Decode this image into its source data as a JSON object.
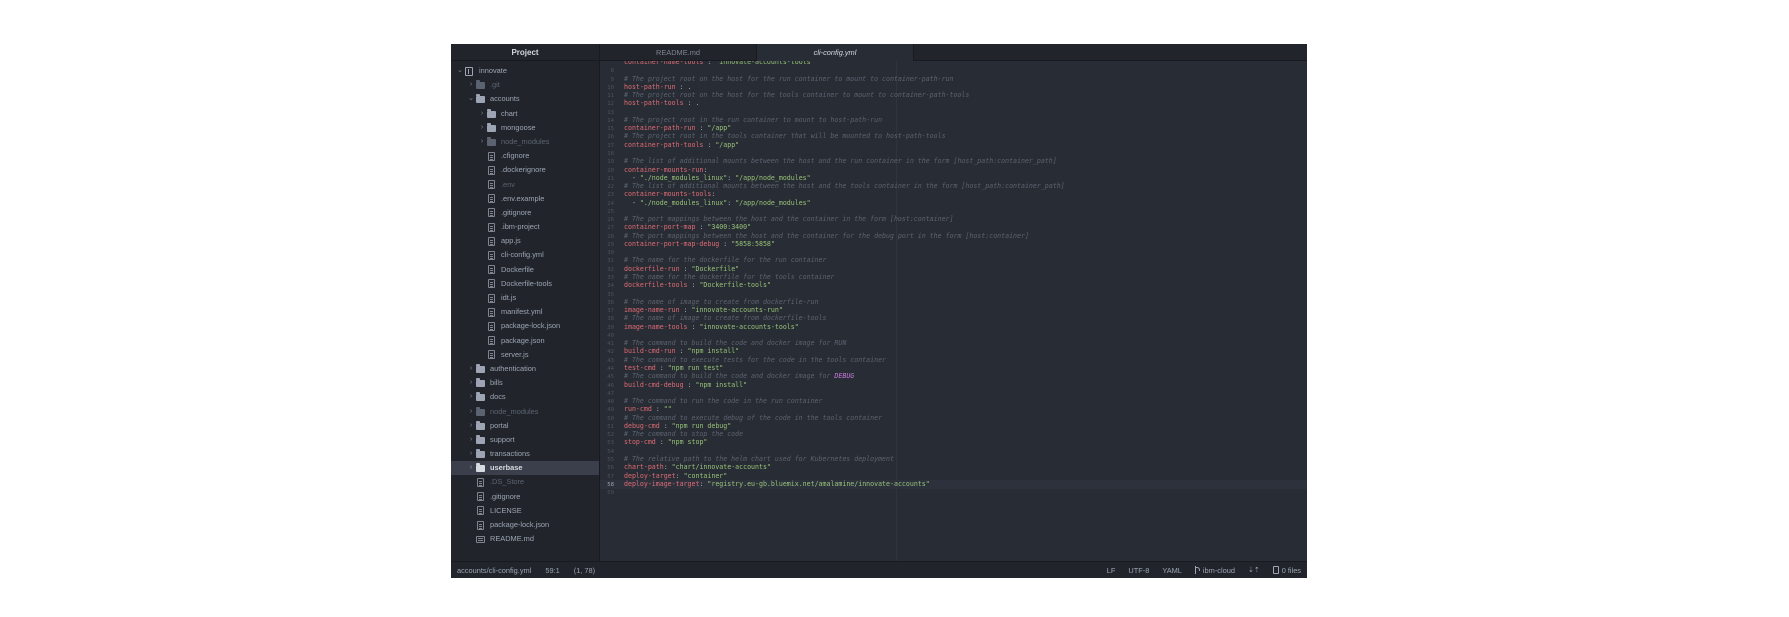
{
  "sidebar": {
    "title": "Project",
    "items": [
      {
        "label": "innovate",
        "kind": "repo",
        "depth": 0,
        "chev": "open"
      },
      {
        "label": ".git",
        "kind": "folder",
        "depth": 1,
        "chev": "closed",
        "dim": true
      },
      {
        "label": "accounts",
        "kind": "folder",
        "depth": 1,
        "chev": "open"
      },
      {
        "label": "chart",
        "kind": "folder",
        "depth": 2,
        "chev": "closed"
      },
      {
        "label": "mongoose",
        "kind": "folder",
        "depth": 2,
        "chev": "closed"
      },
      {
        "label": "node_modules",
        "kind": "folder",
        "depth": 2,
        "chev": "closed",
        "dim": true
      },
      {
        "label": ".cfignore",
        "kind": "file",
        "depth": 2
      },
      {
        "label": ".dockerignore",
        "kind": "file",
        "depth": 2
      },
      {
        "label": ".env",
        "kind": "file",
        "depth": 2,
        "dim": true
      },
      {
        "label": ".env.example",
        "kind": "file",
        "depth": 2
      },
      {
        "label": ".gitignore",
        "kind": "file",
        "depth": 2
      },
      {
        "label": ".ibm-project",
        "kind": "file",
        "depth": 2
      },
      {
        "label": "app.js",
        "kind": "file",
        "depth": 2
      },
      {
        "label": "cli-config.yml",
        "kind": "file",
        "depth": 2
      },
      {
        "label": "Dockerfile",
        "kind": "file",
        "depth": 2
      },
      {
        "label": "Dockerfile-tools",
        "kind": "file",
        "depth": 2
      },
      {
        "label": "idt.js",
        "kind": "file",
        "depth": 2
      },
      {
        "label": "manifest.yml",
        "kind": "file",
        "depth": 2
      },
      {
        "label": "package-lock.json",
        "kind": "file",
        "depth": 2
      },
      {
        "label": "package.json",
        "kind": "file",
        "depth": 2
      },
      {
        "label": "server.js",
        "kind": "file",
        "depth": 2
      },
      {
        "label": "authentication",
        "kind": "folder",
        "depth": 1,
        "chev": "closed"
      },
      {
        "label": "bills",
        "kind": "folder",
        "depth": 1,
        "chev": "closed"
      },
      {
        "label": "docs",
        "kind": "folder",
        "depth": 1,
        "chev": "closed"
      },
      {
        "label": "node_modules",
        "kind": "folder",
        "depth": 1,
        "chev": "closed",
        "dim": true
      },
      {
        "label": "portal",
        "kind": "folder",
        "depth": 1,
        "chev": "closed"
      },
      {
        "label": "support",
        "kind": "folder",
        "depth": 1,
        "chev": "closed"
      },
      {
        "label": "transactions",
        "kind": "folder",
        "depth": 1,
        "chev": "closed"
      },
      {
        "label": "userbase",
        "kind": "folder",
        "depth": 1,
        "chev": "closed",
        "selected": true
      },
      {
        "label": ".DS_Store",
        "kind": "file",
        "depth": 1,
        "dim": true
      },
      {
        "label": ".gitignore",
        "kind": "file",
        "depth": 1
      },
      {
        "label": "LICENSE",
        "kind": "file",
        "depth": 1
      },
      {
        "label": "package-lock.json",
        "kind": "file",
        "depth": 1
      },
      {
        "label": "README.md",
        "kind": "readme",
        "depth": 1
      }
    ]
  },
  "tabs": [
    {
      "label": "README.md",
      "active": false
    },
    {
      "label": "cli-config.yml",
      "active": true
    }
  ],
  "code": {
    "lines": [
      {
        "n": "",
        "t": [
          [
            "k",
            "container-name-tools"
          ],
          [
            "p",
            " : "
          ],
          [
            "s",
            "\"innovate-accounts-tools\""
          ]
        ]
      },
      {
        "n": "8",
        "t": []
      },
      {
        "n": "9",
        "t": [
          [
            "c",
            "# The project root on the host for the run container to mount to container-path-run"
          ]
        ]
      },
      {
        "n": "10",
        "t": [
          [
            "k",
            "host-path-run"
          ],
          [
            "p",
            " : ."
          ]
        ]
      },
      {
        "n": "11",
        "t": [
          [
            "c",
            "# The project root on the host for the tools container to mount to container-path-tools"
          ]
        ]
      },
      {
        "n": "12",
        "t": [
          [
            "k",
            "host-path-tools"
          ],
          [
            "p",
            " : ."
          ]
        ]
      },
      {
        "n": "13",
        "t": []
      },
      {
        "n": "14",
        "t": [
          [
            "c",
            "# The project root in the run container to mount to host-path-run"
          ]
        ]
      },
      {
        "n": "15",
        "t": [
          [
            "k",
            "container-path-run"
          ],
          [
            "p",
            " : "
          ],
          [
            "s",
            "\"/app\""
          ]
        ]
      },
      {
        "n": "16",
        "t": [
          [
            "c",
            "# The project root in the tools container that will be mounted to host-path-tools"
          ]
        ]
      },
      {
        "n": "17",
        "t": [
          [
            "k",
            "container-path-tools"
          ],
          [
            "p",
            " : "
          ],
          [
            "s",
            "\"/app\""
          ]
        ]
      },
      {
        "n": "18",
        "t": []
      },
      {
        "n": "19",
        "t": [
          [
            "c",
            "# The list of additional mounts between the host and the run container in the form [host_path:container_path]"
          ]
        ]
      },
      {
        "n": "20",
        "t": [
          [
            "k",
            "container-mounts-run"
          ],
          [
            "p",
            ":"
          ]
        ]
      },
      {
        "n": "21",
        "t": [
          [
            "p",
            "  - "
          ],
          [
            "s",
            "\"./node_modules_linux\""
          ],
          [
            "p",
            ": "
          ],
          [
            "s",
            "\"/app/node_modules\""
          ]
        ]
      },
      {
        "n": "22",
        "t": [
          [
            "c",
            "# The list of additional mounts between the host and the tools container in the form [host_path:container_path]"
          ]
        ]
      },
      {
        "n": "23",
        "t": [
          [
            "k",
            "container-mounts-tools"
          ],
          [
            "p",
            ":"
          ]
        ]
      },
      {
        "n": "24",
        "t": [
          [
            "p",
            "  - "
          ],
          [
            "s",
            "\"./node_modules_linux\""
          ],
          [
            "p",
            ": "
          ],
          [
            "s",
            "\"/app/node_modules\""
          ]
        ]
      },
      {
        "n": "25",
        "t": []
      },
      {
        "n": "26",
        "t": [
          [
            "c",
            "# The port mappings between the host and the container in the form [host:container]"
          ]
        ]
      },
      {
        "n": "27",
        "t": [
          [
            "k",
            "container-port-map"
          ],
          [
            "p",
            " : "
          ],
          [
            "s",
            "\"3400:3400\""
          ]
        ]
      },
      {
        "n": "28",
        "t": [
          [
            "c",
            "# The port mappings between the host and the container for the debug port in the form [host:container]"
          ]
        ]
      },
      {
        "n": "29",
        "t": [
          [
            "k",
            "container-port-map-debug"
          ],
          [
            "p",
            " : "
          ],
          [
            "s",
            "\"5858:5858\""
          ]
        ]
      },
      {
        "n": "30",
        "t": []
      },
      {
        "n": "31",
        "t": [
          [
            "c",
            "# The name for the dockerfile for the run container"
          ]
        ]
      },
      {
        "n": "32",
        "t": [
          [
            "k",
            "dockerfile-run"
          ],
          [
            "p",
            " : "
          ],
          [
            "s",
            "\"Dockerfile\""
          ]
        ]
      },
      {
        "n": "33",
        "t": [
          [
            "c",
            "# The name for the dockerfile for the tools container"
          ]
        ]
      },
      {
        "n": "34",
        "t": [
          [
            "k",
            "dockerfile-tools"
          ],
          [
            "p",
            " : "
          ],
          [
            "s",
            "\"Dockerfile-tools\""
          ]
        ]
      },
      {
        "n": "35",
        "t": []
      },
      {
        "n": "36",
        "t": [
          [
            "c",
            "# The name of image to create from dockerfile-run"
          ]
        ]
      },
      {
        "n": "37",
        "t": [
          [
            "k",
            "image-name-run"
          ],
          [
            "p",
            " : "
          ],
          [
            "s",
            "\"innovate-accounts-run\""
          ]
        ]
      },
      {
        "n": "38",
        "t": [
          [
            "c",
            "# The name of image to create from dockerfile-tools"
          ]
        ]
      },
      {
        "n": "39",
        "t": [
          [
            "k",
            "image-name-tools"
          ],
          [
            "p",
            " : "
          ],
          [
            "s",
            "\"innovate-accounts-tools\""
          ]
        ]
      },
      {
        "n": "40",
        "t": []
      },
      {
        "n": "41",
        "t": [
          [
            "c",
            "# The command to build the code and docker image for RUN"
          ]
        ]
      },
      {
        "n": "42",
        "t": [
          [
            "k",
            "build-cmd-run"
          ],
          [
            "p",
            " : "
          ],
          [
            "s",
            "\"npm install\""
          ]
        ]
      },
      {
        "n": "43",
        "t": [
          [
            "c",
            "# The command to execute tests for the code in the tools container"
          ]
        ]
      },
      {
        "n": "44",
        "t": [
          [
            "k",
            "test-cmd"
          ],
          [
            "p",
            " : "
          ],
          [
            "s",
            "\"npm run test\""
          ]
        ]
      },
      {
        "n": "45",
        "t": [
          [
            "c",
            "# The command to build the code and docker image for "
          ],
          [
            "kw",
            "DEBUG"
          ]
        ]
      },
      {
        "n": "46",
        "t": [
          [
            "k",
            "build-cmd-debug"
          ],
          [
            "p",
            " : "
          ],
          [
            "s",
            "\"npm install\""
          ]
        ]
      },
      {
        "n": "47",
        "t": []
      },
      {
        "n": "48",
        "t": [
          [
            "c",
            "# The command to run the code in the run container"
          ]
        ]
      },
      {
        "n": "49",
        "t": [
          [
            "k",
            "run-cmd"
          ],
          [
            "p",
            " : "
          ],
          [
            "s",
            "\"\""
          ]
        ]
      },
      {
        "n": "50",
        "t": [
          [
            "c",
            "# The command to execute debug of the code in the tools container"
          ]
        ]
      },
      {
        "n": "51",
        "t": [
          [
            "k",
            "debug-cmd"
          ],
          [
            "p",
            " : "
          ],
          [
            "s",
            "\"npm run debug\""
          ]
        ]
      },
      {
        "n": "52",
        "t": [
          [
            "c",
            "# The command to stop the code"
          ]
        ]
      },
      {
        "n": "53",
        "t": [
          [
            "k",
            "stop-cmd"
          ],
          [
            "p",
            " : "
          ],
          [
            "s",
            "\"npm stop\""
          ]
        ]
      },
      {
        "n": "54",
        "t": []
      },
      {
        "n": "55",
        "t": [
          [
            "c",
            "# The relative path to the helm chart used for Kubernetes deployment"
          ]
        ]
      },
      {
        "n": "56",
        "t": [
          [
            "k",
            "chart-path"
          ],
          [
            "p",
            ": "
          ],
          [
            "s",
            "\"chart/innovate-accounts\""
          ]
        ]
      },
      {
        "n": "57",
        "t": [
          [
            "k",
            "deploy-target"
          ],
          [
            "p",
            ": "
          ],
          [
            "s",
            "\"container\""
          ]
        ]
      },
      {
        "n": "58",
        "t": [
          [
            "k",
            "deploy-image-target"
          ],
          [
            "p",
            ": "
          ],
          [
            "s",
            "\"registry.eu-gb.bluemix.net/amalamine/innovate-accounts\""
          ]
        ],
        "cursor": true
      },
      {
        "n": "59",
        "t": []
      }
    ]
  },
  "status": {
    "file_path": "accounts/cli-config.yml",
    "cursor_pos": "59:1",
    "selection": "(1, 78)",
    "line_ending": "LF",
    "encoding": "UTF-8",
    "grammar": "YAML",
    "branch": "ibm-cloud",
    "fetch": "⇣⇡",
    "files": "0 files"
  },
  "colors": {
    "editor_bg": "#282c34",
    "sidebar_bg": "#21252b",
    "key": "#e06c75",
    "string": "#98c379",
    "comment": "#5c6370",
    "keyword": "#c678dd"
  }
}
